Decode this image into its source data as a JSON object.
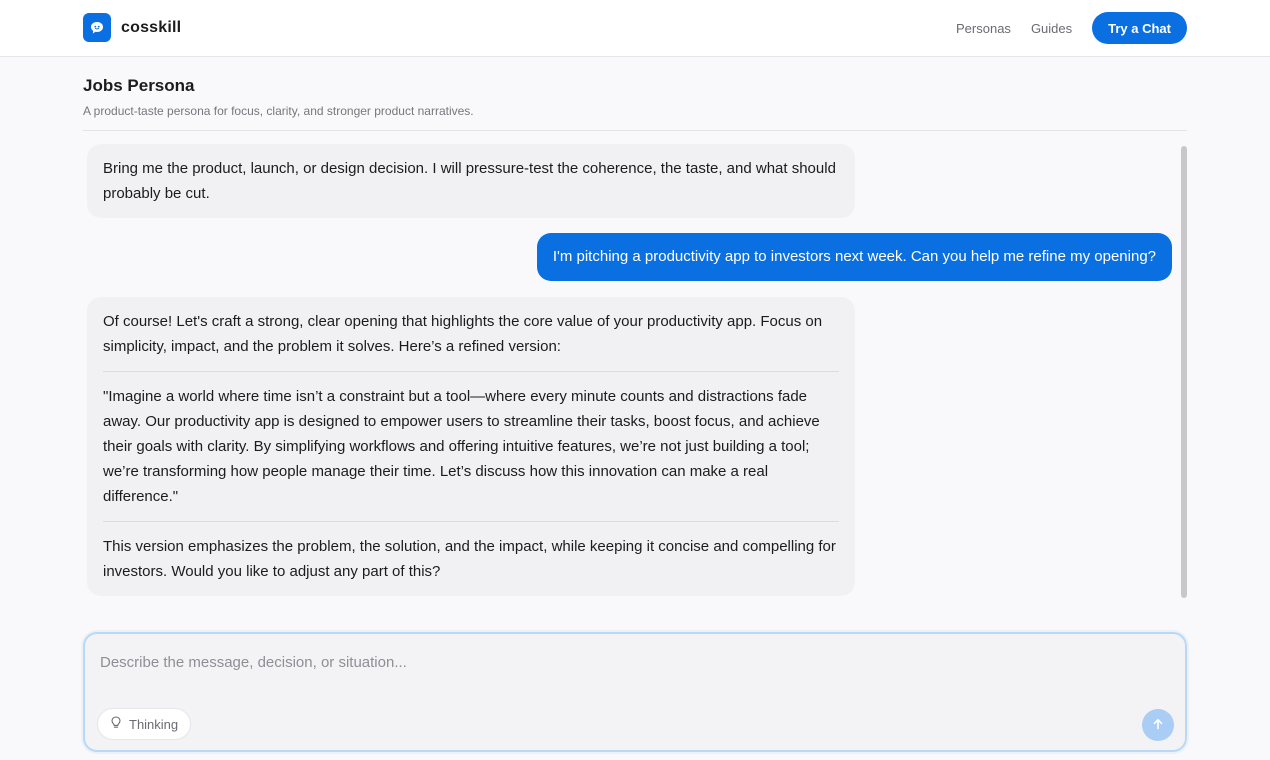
{
  "brand": {
    "name": "cosskill",
    "logo_icon": "chat-bubble-face-icon",
    "color": "#0a6fe0"
  },
  "nav": {
    "links": [
      "Personas",
      "Guides"
    ],
    "cta_label": "Try a Chat"
  },
  "page": {
    "title": "Jobs Persona",
    "subtitle": "A product-taste persona for focus, clarity, and stronger product narratives."
  },
  "messages": [
    {
      "role": "assistant",
      "paragraphs": [
        "Bring me the product, launch, or design decision. I will pressure-test the coherence, the taste, and what should probably be cut."
      ]
    },
    {
      "role": "user",
      "text": "I'm pitching a productivity app to investors next week. Can you help me refine my opening?"
    },
    {
      "role": "assistant",
      "paragraphs": [
        "Of course! Let's craft a strong, clear opening that highlights the core value of your productivity app. Focus on simplicity, impact, and the problem it solves. Here’s a refined version:",
        "\"Imagine a world where time isn’t a constraint but a tool—where every minute counts and distractions fade away. Our productivity app is designed to empower users to streamline their tasks, boost focus, and achieve their goals with clarity. By simplifying workflows and offering intuitive features, we’re not just building a tool; we’re transforming how people manage their time. Let’s discuss how this innovation can make a real difference.\"",
        "This version emphasizes the problem, the solution, and the impact, while keeping it concise and compelling for investors. Would you like to adjust any part of this?"
      ]
    }
  ],
  "composer": {
    "placeholder": "Describe the message, decision, or situation...",
    "value": "",
    "thinking_label": "Thinking",
    "thinking_icon": "lightbulb-icon",
    "send_icon": "arrow-up-icon"
  }
}
